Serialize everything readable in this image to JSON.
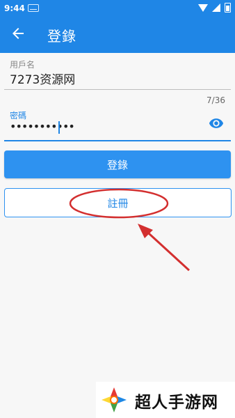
{
  "status_bar": {
    "time": "9:44"
  },
  "app_bar": {
    "title": "登錄"
  },
  "form": {
    "username": {
      "label": "用戶名",
      "value": "7273资源网",
      "counter": "7/36"
    },
    "password": {
      "label": "密碼",
      "value": "•••••••••••"
    }
  },
  "buttons": {
    "login": "登錄",
    "register": "註冊"
  },
  "watermark": {
    "text": "超人手游网"
  },
  "colors": {
    "accent": "#1f86e6",
    "annotation": "#d32f2f"
  },
  "icons": {
    "back": "arrow-left-icon",
    "password_toggle": "eye-icon"
  }
}
